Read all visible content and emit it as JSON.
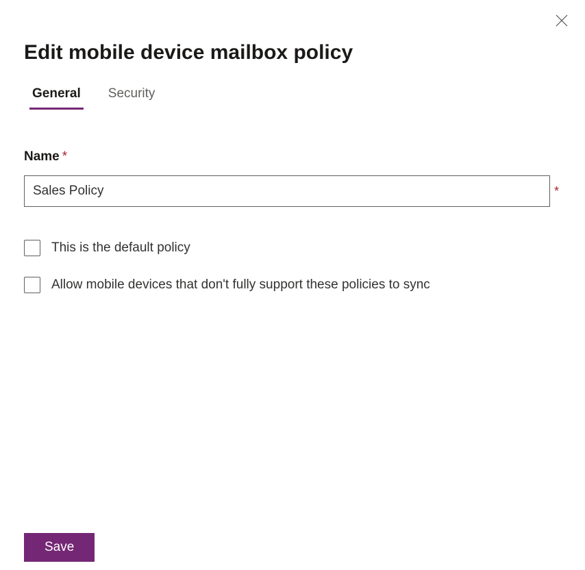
{
  "header": {
    "title": "Edit mobile device mailbox policy"
  },
  "tabs": {
    "general": "General",
    "security": "Security",
    "active": "general"
  },
  "form": {
    "name_label": "Name",
    "name_value": "Sales Policy",
    "required_mark": "*",
    "checkbox_default_label": "This is the default policy",
    "checkbox_default_checked": false,
    "checkbox_allow_label": "Allow mobile devices that don't fully support these policies to sync",
    "checkbox_allow_checked": false
  },
  "actions": {
    "save_label": "Save"
  }
}
